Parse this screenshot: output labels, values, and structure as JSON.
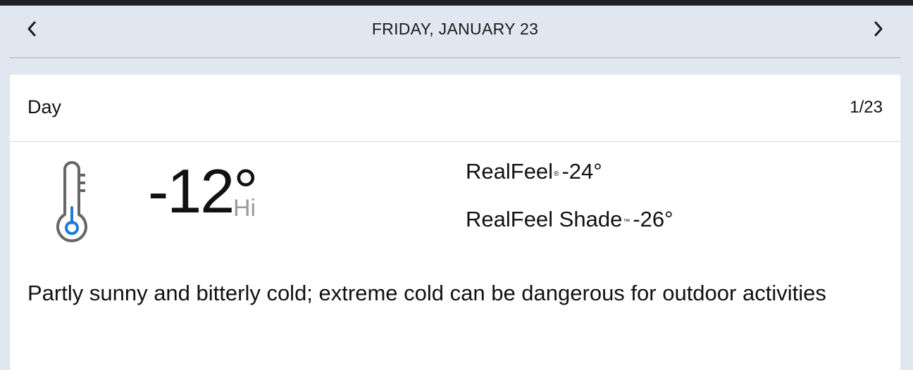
{
  "header": {
    "date_title": "FRIDAY, JANUARY 23",
    "prev_icon": "chevron-left-icon",
    "next_icon": "chevron-right-icon"
  },
  "forecast": {
    "period_label": "Day",
    "period_date": "1/23",
    "icon": "thermometer-icon",
    "temperature": "-12°",
    "temperature_qualifier": "Hi",
    "realfeel_label": "RealFeel",
    "realfeel_mark": "®",
    "realfeel_value": "-24°",
    "realfeel_shade_label": "RealFeel Shade",
    "realfeel_shade_mark": "™",
    "realfeel_shade_value": "-26°",
    "phrase": "Partly sunny and bitterly cold; extreme cold can be dangerous for outdoor activities"
  },
  "colors": {
    "page_background": "#e1e7f1",
    "card_background": "#ffffff",
    "thermometer_stroke": "#666666",
    "thermometer_accent": "#1e7bd6",
    "muted_text": "#9b9b9b"
  }
}
